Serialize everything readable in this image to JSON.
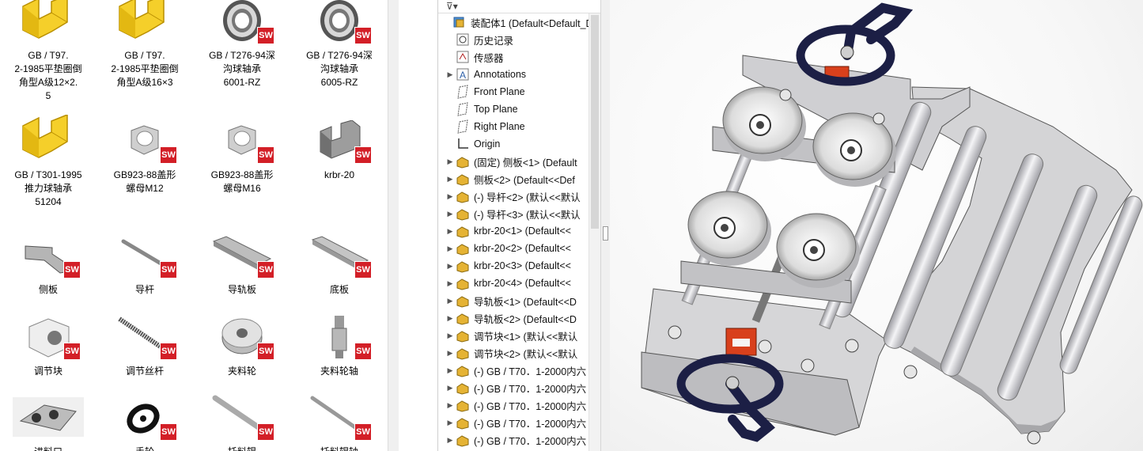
{
  "explorer": {
    "items": [
      {
        "label": "GB / T97.\n2-1985平垫圈倒\n角型A级12×2.\n5",
        "icon": "part-placeholder-icon"
      },
      {
        "label": "GB / T97.\n2-1985平垫圈倒\n角型A级16×3",
        "icon": "part-placeholder-icon"
      },
      {
        "label": "GB / T276-94深\n沟球轴承\n6001-RZ",
        "icon": "bearing-icon"
      },
      {
        "label": "GB / T276-94深\n沟球轴承\n6005-RZ",
        "icon": "bearing-icon"
      },
      {
        "label": "GB / T301-1995\n推力球轴承\n51204",
        "icon": "part-placeholder-icon"
      },
      {
        "label": "GB923-88盖形\n螺母M12",
        "icon": "cap-nut-icon"
      },
      {
        "label": "GB923-88盖形\n螺母M16",
        "icon": "cap-nut-icon"
      },
      {
        "label": "krbr-20",
        "icon": "block-icon"
      },
      {
        "label": "侧板",
        "icon": "side-plate-icon"
      },
      {
        "label": "导杆",
        "icon": "rod-icon"
      },
      {
        "label": "导轨板",
        "icon": "rail-plate-icon"
      },
      {
        "label": "底板",
        "icon": "base-plate-icon"
      },
      {
        "label": "调节块",
        "icon": "adjust-block-icon"
      },
      {
        "label": "调节丝杆",
        "icon": "screw-rod-icon"
      },
      {
        "label": "夹料轮",
        "icon": "pulley-icon"
      },
      {
        "label": "夹料轮轴",
        "icon": "shaft-icon"
      },
      {
        "label": "进料口",
        "icon": "assembly-icon"
      },
      {
        "label": "手轮",
        "icon": "handwheel-icon"
      },
      {
        "label": "托料辊",
        "icon": "roller-icon"
      },
      {
        "label": "托料辊轴",
        "icon": "roller-shaft-icon"
      }
    ],
    "badge_text": "SW"
  },
  "tree": {
    "root": "装配体1  (Default<Default_D",
    "items": [
      {
        "label": "历史记录",
        "icon": "history-icon",
        "expandable": false
      },
      {
        "label": "传感器",
        "icon": "sensor-icon",
        "expandable": false
      },
      {
        "label": "Annotations",
        "icon": "annotations-icon",
        "expandable": true
      },
      {
        "label": "Front Plane",
        "icon": "plane-icon",
        "expandable": false
      },
      {
        "label": "Top Plane",
        "icon": "plane-icon",
        "expandable": false
      },
      {
        "label": "Right Plane",
        "icon": "plane-icon",
        "expandable": false
      },
      {
        "label": "Origin",
        "icon": "origin-icon",
        "expandable": false
      },
      {
        "label": "(固定) 侧板<1>  (Default",
        "icon": "part-icon",
        "expandable": true
      },
      {
        "label": "侧板<2>  (Default<<Def",
        "icon": "part-icon",
        "expandable": true
      },
      {
        "label": "(-) 导杆<2>  (默认<<默认",
        "icon": "part-icon",
        "expandable": true
      },
      {
        "label": "(-) 导杆<3>  (默认<<默认",
        "icon": "part-icon",
        "expandable": true
      },
      {
        "label": "krbr-20<1>  (Default<<",
        "icon": "part-icon",
        "expandable": true
      },
      {
        "label": "krbr-20<2>  (Default<<",
        "icon": "part-icon",
        "expandable": true
      },
      {
        "label": "krbr-20<3>  (Default<<",
        "icon": "part-icon",
        "expandable": true
      },
      {
        "label": "krbr-20<4>  (Default<<",
        "icon": "part-icon",
        "expandable": true
      },
      {
        "label": "导轨板<1>  (Default<<D",
        "icon": "part-icon",
        "expandable": true
      },
      {
        "label": "导轨板<2>  (Default<<D",
        "icon": "part-icon",
        "expandable": true
      },
      {
        "label": "调节块<1>  (默认<<默认",
        "icon": "part-icon",
        "expandable": true
      },
      {
        "label": "调节块<2>  (默认<<默认",
        "icon": "part-icon",
        "expandable": true
      },
      {
        "label": "(-) GB / T70．1-2000内六",
        "icon": "part-icon",
        "expandable": true
      },
      {
        "label": "(-) GB / T70．1-2000内六",
        "icon": "part-icon",
        "expandable": true
      },
      {
        "label": "(-) GB / T70．1-2000内六",
        "icon": "part-icon",
        "expandable": true
      },
      {
        "label": "(-) GB / T70．1-2000内六",
        "icon": "part-icon",
        "expandable": true
      },
      {
        "label": "(-) GB / T70．1-2000内六",
        "icon": "part-icon",
        "expandable": true
      }
    ]
  },
  "colors": {
    "placeholder_yellow": "#f5cf2a",
    "sw_red": "#d31f27",
    "part_gray": "#c8c8c8",
    "wheel_navy": "#1c1f45",
    "tree_folder": "#e5b334"
  }
}
